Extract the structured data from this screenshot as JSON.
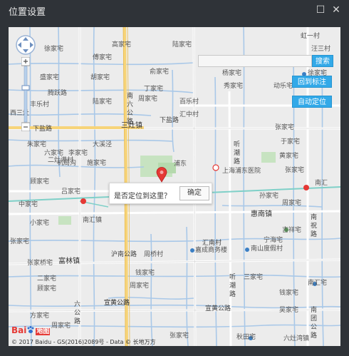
{
  "window": {
    "title": "位置设置",
    "maximize_glyph": "☐",
    "close_glyph": "✕"
  },
  "map": {
    "search_placeholder": "",
    "search_button": "搜索",
    "back_to_mark_button": "回到标注",
    "auto_locate_button": "自动定位",
    "popup_question": "是否定位到这里？",
    "popup_confirm": "确定",
    "logo_text": "Bai",
    "logo_text2": "地图",
    "copyright": "© 2017 Baidu - GS(2016)2089号 - Data © 长地万方",
    "labels": {
      "l1": "徐家宅",
      "l2": "高家宅",
      "l3": "傅家宅",
      "l4": "陆家宅",
      "l5": "虹一村",
      "l6": "汪三村",
      "l7": "徐家宅",
      "l8": "盛家宅",
      "l9": "胡家宅",
      "l10": "俞家宅",
      "l11": "杨家宅",
      "l12": "丁家宅",
      "l13": "腾跃路",
      "l14": "陆家宅",
      "l15": "南",
      "l16": "六",
      "l17": "公",
      "l18": "路",
      "l19": "周家宅",
      "l20": "秀家宅",
      "l21": "动乐宅",
      "l22": "百乐村",
      "l23": "汇中村",
      "l24": "丰乐村",
      "l25": "三灶镇",
      "l26": "下盐路",
      "l27": "西三灶",
      "l28": "下盐路",
      "l29": "张家宅",
      "l30": "朱家宅",
      "l31": "大溪泾",
      "l32": "六家宅",
      "l33": "二灶港村",
      "l34": "李家宅",
      "l35": "机局沟",
      "l36": "施家宅",
      "l37": "听",
      "l38": "潮",
      "l39": "路",
      "l40": "上海浦东医院",
      "l41": "于家宅",
      "l42": "张家宅",
      "l43": "南汇",
      "l44": "顾家宅",
      "l45": "吕家宅",
      "l46": "周家宅",
      "l47": "小家宅",
      "l48": "南汇镇",
      "l49": "孙家宅",
      "l50": "惠南镇",
      "l51": "南",
      "l52": "祝",
      "l53": "路",
      "l54": "吉祥宅",
      "l55": "宁海宅",
      "l56": "张家宅",
      "l57": "汇南村",
      "l58": "沪南公路",
      "l59": "周桥村",
      "l60": "富林镇",
      "l61": "嘉成商务楼",
      "l62": "南山度假村",
      "l63": "张家桥宅",
      "l64": "钱家宅",
      "l65": "二家宅",
      "l66": "周家宅",
      "l67": "宣黄公路",
      "l68": "听",
      "l69": "潮",
      "l70": "路",
      "l71": "三家宅",
      "l72": "钱家宅",
      "l73": "顾家宅",
      "l74": "南汇宅",
      "l75": "方家宅",
      "l76": "宣黄公路",
      "l77": "宣黄公路",
      "l78": "六",
      "l79": "公",
      "l80": "路",
      "l81": "吴家宅",
      "l82": "六灶湾镇",
      "l83": "秋田宅",
      "l84": "南",
      "l85": "团",
      "l86": "公",
      "l87": "路",
      "l88": "周家宅",
      "l89": "张家宅",
      "l90": "黄家宅",
      "l91": "中家宅",
      "l92": "浦东"
    }
  },
  "colors": {
    "accent": "#32a9e8",
    "titlebar": "#2f3338",
    "marker": "#e53935",
    "road_yellow": "#f7d479",
    "water": "#a9c8e8"
  }
}
